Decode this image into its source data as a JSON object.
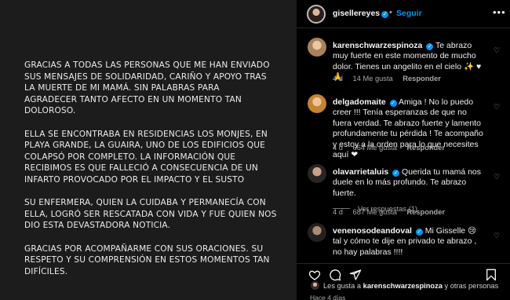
{
  "post": {
    "caption": "GRACIAS A TODAS LAS PERSONAS QUE ME HAN ENVIADO\nSUS MENSAJES DE SOLIDARIDAD, CARIÑO Y APOYO TRAS\nLA MUERTE DE MI MAMÁ. SIN PALABRAS PARA\nAGRADECER TANTO AFECTO EN UN MOMENTO TAN\nDOLOROSO.\n\nELLA SE ENCONTRABA EN RESIDENCIAS LOS MONJES, EN\nPLAYA GRANDE, LA GUAIRA, UNO DE LOS EDIFICIOS QUE\nCOLAPSÓ POR COMPLETO. LA INFORMACIÓN QUE\nRECIBIMOS ES QUE FALLECIÓ A CONSECUENCIA DE UN\nINFARTO PROVOCADO POR EL IMPACTO Y EL SUSTO\n\nSU ENFERMERA, QUIEN LA CUIDABA Y PERMANECÍA CON\nELLA, LOGRÓ SER RESCATADA CON VIDA Y FUE QUIEN NOS\nDIO ESTA DEVASTADORA NOTICIA.\n\nGRACIAS POR ACOMPAÑARME CON SUS ORACIONES. SU\nRESPETO Y SU COMPRENSIÓN EN ESTOS MOMENTOS TAN\nDIFÍCILES."
  },
  "header": {
    "username": "gisellereyes",
    "verified_mark": "✓",
    "separator": "•",
    "follow_label": "Seguir",
    "more_icon": "more-horizontal-icon"
  },
  "comments": [
    {
      "username": "karenschwarzespinoza",
      "verified_mark": "✓",
      "text": "Te abrazo muy fuerte en este momento de mucho dolor. Tienes un angelito en el cielo ✨ ♥ 🙏",
      "time": "4 d",
      "likes": "14 Me gusta",
      "reply_label": "Responder"
    },
    {
      "username": "delgadomaite",
      "verified_mark": "✓",
      "text": "Amiga ! No lo puedo creer !!! Tenía esperanzas de que no fuera verdad. Te abrazo fuerte y lamento profundamente tu pérdida ! Te acompaño y estoy a la orden para lo que necesites aquí ❤",
      "time": "4 d",
      "likes": "664 Me gusta",
      "reply_label": "Responder"
    },
    {
      "username": "olavarrietaluis",
      "verified_mark": "✓",
      "text": "Querida tu mamá nos duele en lo más profundo. Te abrazo fuerte.",
      "time": "4 d",
      "likes": "687 Me gusta",
      "reply_label": "Responder"
    },
    {
      "username": "venenosodeandoval",
      "verified_mark": "✓",
      "text": "Mi Gisselle 😢 tal y cómo te dije en privado te abrazo , no hay palabras !!!!",
      "time": "",
      "likes": "",
      "reply_label": ""
    }
  ],
  "view_replies_label": "Ver respuestas (1)",
  "footer": {
    "likes_prefix": "Les gusta a ",
    "likes_user": "karenschwarzespinoza",
    "likes_suffix": " y otras personas",
    "time_ago": "Hace 4 días"
  },
  "colors": {
    "accent": "#0095f6",
    "background": "#000000",
    "post_background": "#1c1c1c",
    "muted": "#a8a8a8",
    "like_red": "#ff3040"
  }
}
